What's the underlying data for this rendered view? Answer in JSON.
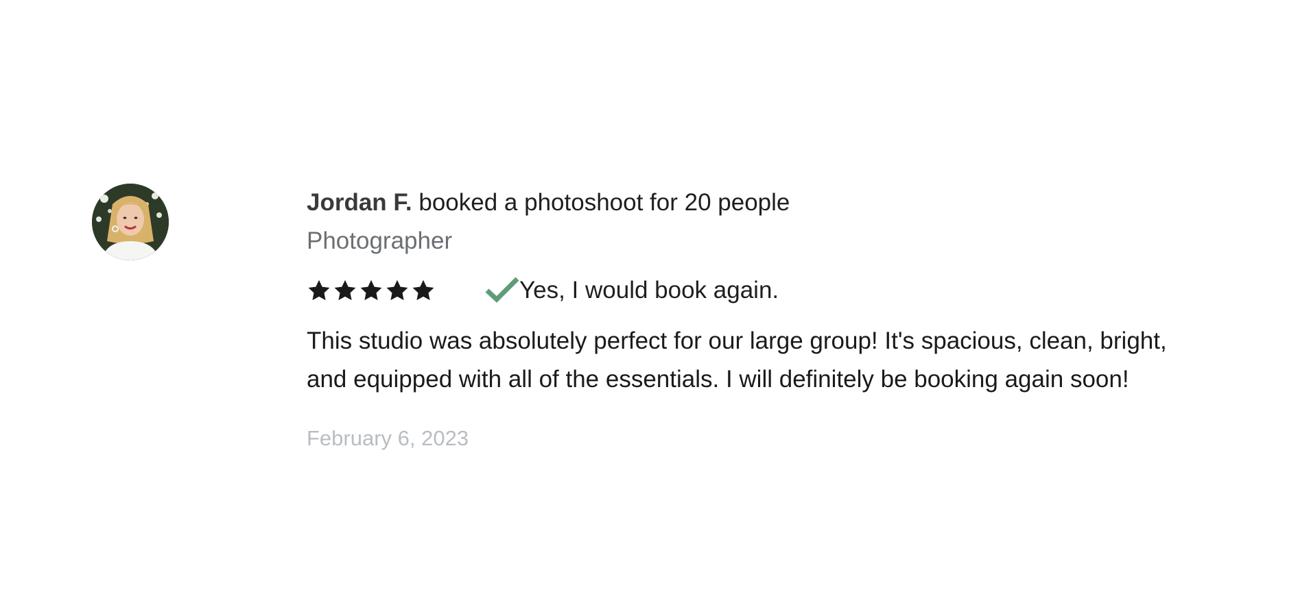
{
  "review": {
    "reviewer_name": "Jordan F.",
    "headline_rest": " booked a photoshoot for 20 people",
    "role": "Photographer",
    "rating": 5,
    "rating_max": 5,
    "recommend_text": "Yes, I would book again.",
    "body": "This studio was absolutely perfect for our large group! It's spacious, clean, bright, and equipped with all of the essentials. I will definitely be booking again soon!",
    "date": "February 6, 2023"
  },
  "icons": {
    "avatar": "avatar-photo",
    "star": "star-icon",
    "check": "check-icon"
  },
  "colors": {
    "star": "#1a1a1a",
    "check": "#5f9c79",
    "role_text": "#6b6e73",
    "date_text": "#b9bdc2"
  }
}
